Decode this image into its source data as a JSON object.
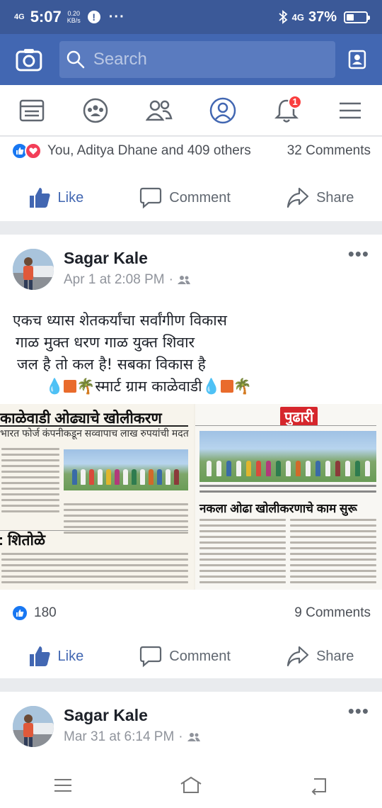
{
  "status_bar": {
    "network": "4G",
    "time": "5:07",
    "speed_value": "0.20",
    "speed_unit": "KB/s",
    "alert": "!",
    "more": "···",
    "signal": "4G",
    "battery": "37%",
    "battery_level": 0.37
  },
  "top_bar": {
    "search_placeholder": "Search"
  },
  "nav": {
    "notifications_badge": "1"
  },
  "post1": {
    "reactions_text": "You, Aditya Dhane and 409 others",
    "comments_text": "32 Comments",
    "like_label": "Like",
    "comment_label": "Comment",
    "share_label": "Share"
  },
  "post2": {
    "author": "Sagar Kale",
    "timestamp": "Apr 1 at 2:08 PM",
    "meta_sep": "·",
    "text_line1": "एकच ध्यास शेतकर्यांचा सर्वांगीण विकास",
    "text_line2": "गाळ मुक्त धरण गाळ युक्त शिवार",
    "text_line3": "जल है तो कल है! सबका विकास है",
    "text_line4": "स्मार्ट ग्राम काळेवाडी",
    "news_left_headline": "काळेवाडी ओढ्याचे खोलीकरण",
    "news_left_subhead": "भारत फोर्ज कंपनीकडून सव्वापाच लाख रुपयांची मदत",
    "news_left_side_head": ": शितोळे",
    "news_right_logo": "पुढारी",
    "news_right_headline": "नकला ओढा खोलीकरणाचे काम सुरू",
    "likes_count": "180",
    "comments_text": "9 Comments",
    "like_label": "Like",
    "comment_label": "Comment",
    "share_label": "Share"
  },
  "post3": {
    "author": "Sagar Kale",
    "timestamp": "Mar 31 at 6:14 PM",
    "meta_sep": "·"
  },
  "colors": {
    "brand": "#4267b2",
    "status_bar": "#3b5998",
    "like_blue": "#1877f2",
    "love_red": "#f33e58",
    "badge_red": "#fa3e3e"
  }
}
